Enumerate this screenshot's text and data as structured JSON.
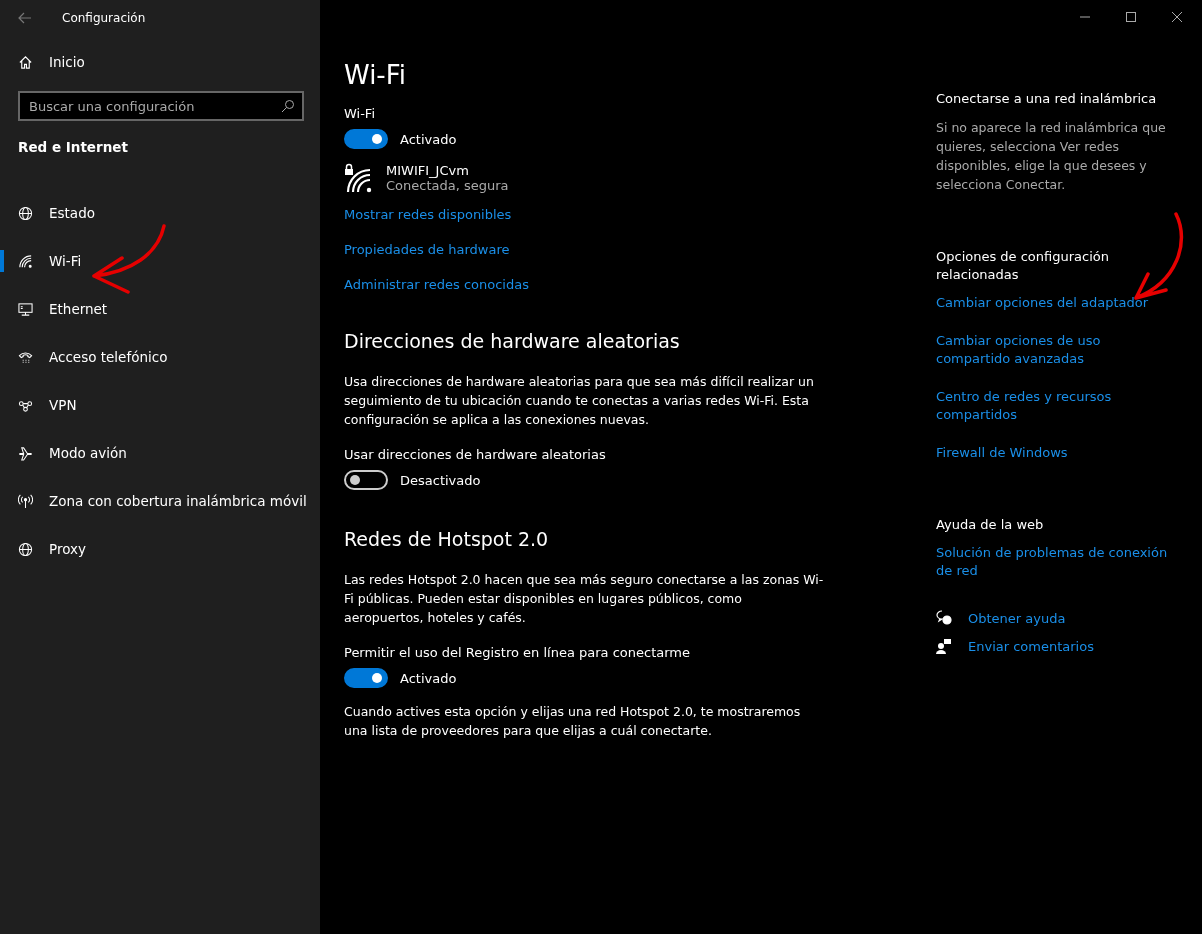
{
  "window": {
    "title": "Configuración"
  },
  "sidebar": {
    "home": "Inicio",
    "search": {
      "placeholder": "Buscar una configuración"
    },
    "section": "Red e Internet",
    "items": [
      {
        "label": "Estado",
        "selected": false
      },
      {
        "label": "Wi-Fi",
        "selected": true
      },
      {
        "label": "Ethernet",
        "selected": false
      },
      {
        "label": "Acceso telefónico",
        "selected": false
      },
      {
        "label": "VPN",
        "selected": false
      },
      {
        "label": "Modo avión",
        "selected": false
      },
      {
        "label": "Zona con cobertura inalámbrica móvil",
        "selected": false
      },
      {
        "label": "Proxy",
        "selected": false
      }
    ]
  },
  "page": {
    "title": "Wi-Fi",
    "wifi": {
      "label": "Wi-Fi",
      "on": true,
      "state": "Activado"
    },
    "network": {
      "name": "MIWIFI_JCvm",
      "status": "Conectada, segura"
    },
    "links": [
      "Mostrar redes disponibles",
      "Propiedades de hardware",
      "Administrar redes conocidas"
    ],
    "random": {
      "heading": "Direcciones de hardware aleatorias",
      "text": "Usa direcciones de hardware aleatorias para que sea más difícil realizar un seguimiento de tu ubicación cuando te conectas a varias redes Wi-Fi. Esta configuración se aplica a las conexiones nuevas.",
      "toggle": {
        "label": "Usar direcciones de hardware aleatorias",
        "on": false,
        "state": "Desactivado"
      }
    },
    "hotspot": {
      "heading": "Redes de Hotspot 2.0",
      "text": "Las redes Hotspot 2.0 hacen que sea más seguro conectarse a las zonas Wi-Fi públicas. Pueden estar disponibles en lugares públicos, como aeropuertos, hoteles y cafés.",
      "toggle": {
        "label": "Permitir el uso del Registro en línea para conectarme",
        "on": true,
        "state": "Activado"
      },
      "note": "Cuando actives esta opción y elijas una red Hotspot 2.0, te mostraremos una lista de proveedores para que elijas a cuál conectarte."
    }
  },
  "aside": {
    "connect": {
      "heading": "Conectarse a una red inalámbrica",
      "text": "Si no aparece la red inalámbrica que quieres, selecciona Ver redes disponibles, elige la que desees y selecciona Conectar."
    },
    "related": {
      "heading": "Opciones de configuración relacionadas",
      "links": [
        "Cambiar opciones del adaptador",
        "Cambiar opciones de uso compartido avanzadas",
        "Centro de redes y recursos compartidos",
        "Firewall de Windows"
      ]
    },
    "web": {
      "heading": "Ayuda de la web",
      "links": [
        "Solución de problemas de conexión de red"
      ]
    },
    "help": [
      "Obtener ayuda",
      "Enviar comentarios"
    ]
  }
}
